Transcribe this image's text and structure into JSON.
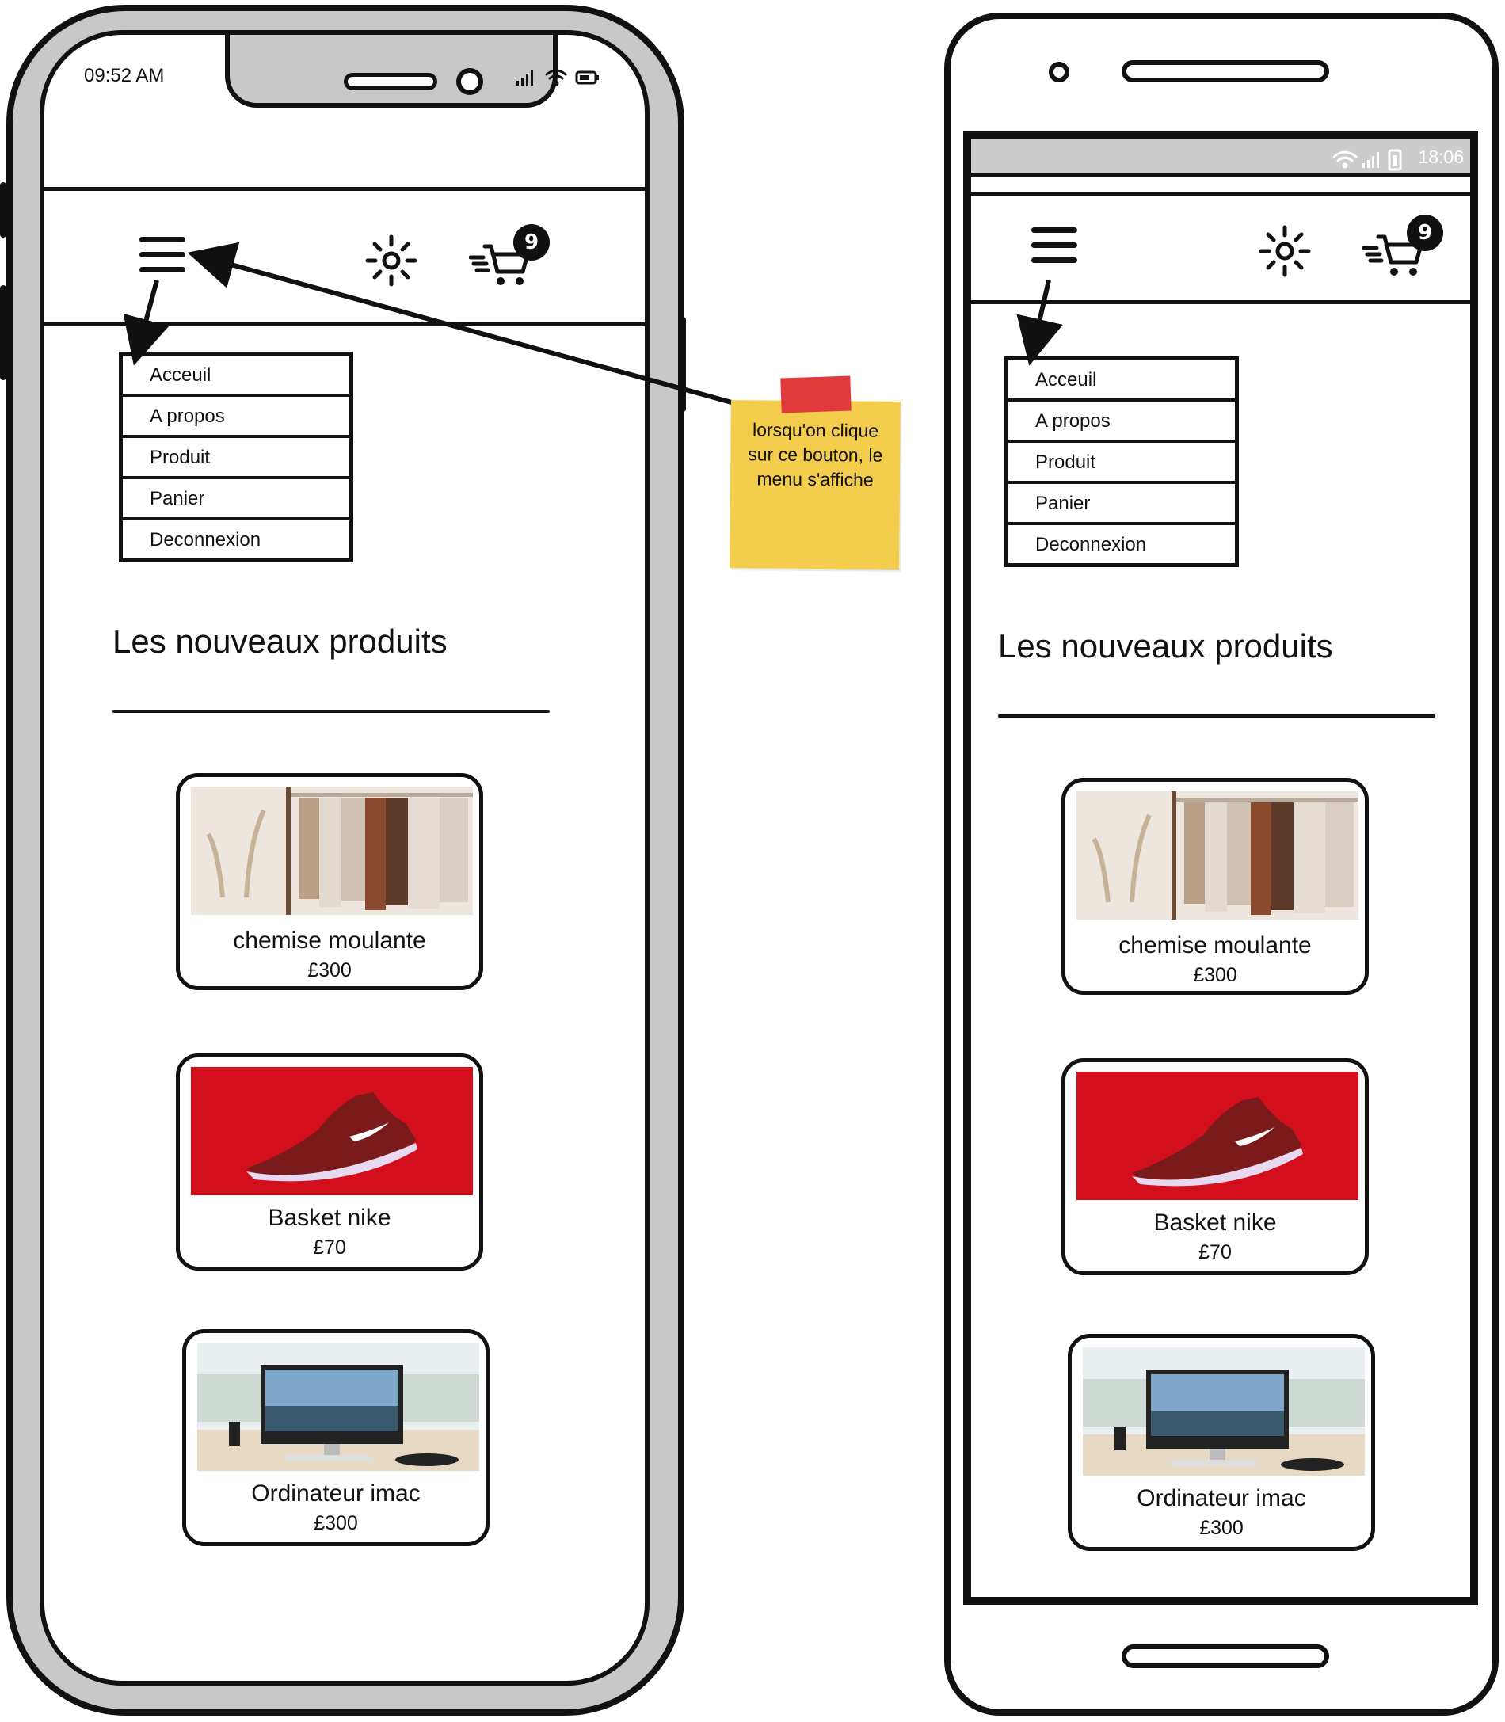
{
  "iphone": {
    "status_time": "09:52 AM"
  },
  "android": {
    "status_time": "18:06"
  },
  "app": {
    "cart_count": "9",
    "menu_items": [
      "Acceuil",
      "A propos",
      "Produit",
      "Panier",
      "Deconnexion"
    ],
    "section_title": "Les nouveaux produits",
    "products": [
      {
        "name": "chemise moulante",
        "price": "£300",
        "image": "clothing-rack-photo"
      },
      {
        "name": "Basket nike",
        "price": "£70",
        "image": "red-sneaker-photo"
      },
      {
        "name": "Ordinateur imac",
        "price": "£300",
        "image": "imac-desk-photo"
      }
    ]
  },
  "annotation": {
    "note_text": "lorsqu'on clique sur ce bouton, le menu s'affiche",
    "note_color": "#f4cd4c",
    "tape_color": "#e03a3a"
  },
  "icons": [
    "hamburger-icon",
    "sun-icon",
    "cart-icon",
    "signal-icon",
    "wifi-icon",
    "battery-icon"
  ]
}
